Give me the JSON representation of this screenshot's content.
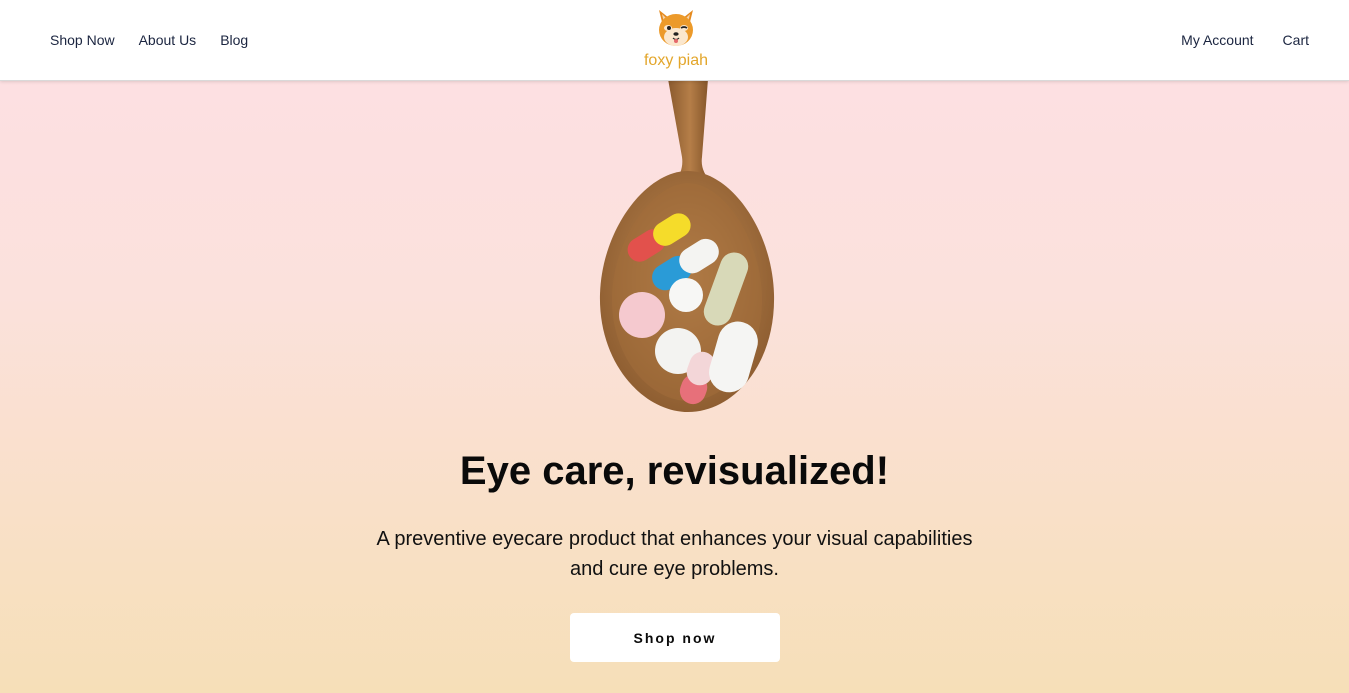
{
  "header": {
    "nav_left": [
      {
        "label": "Shop Now"
      },
      {
        "label": "About Us"
      },
      {
        "label": "Blog"
      }
    ],
    "logo_text": "foxy piah",
    "logo_icon": "shiba-dog-face-icon",
    "nav_right": [
      {
        "label": "My Account"
      },
      {
        "label": "Cart"
      }
    ]
  },
  "hero": {
    "image": "wooden-spoon-with-pills",
    "headline": "Eye care, revisualized!",
    "subtext": "A preventive eyecare product that enhances your visual capabilities and cure eye problems.",
    "cta_label": "Shop now"
  },
  "colors": {
    "nav_text": "#1b2540",
    "logo_text": "#e3a62b",
    "hero_top": "#fde0e2",
    "hero_bottom": "#f6dfb8",
    "headline": "#0a0a0a"
  }
}
